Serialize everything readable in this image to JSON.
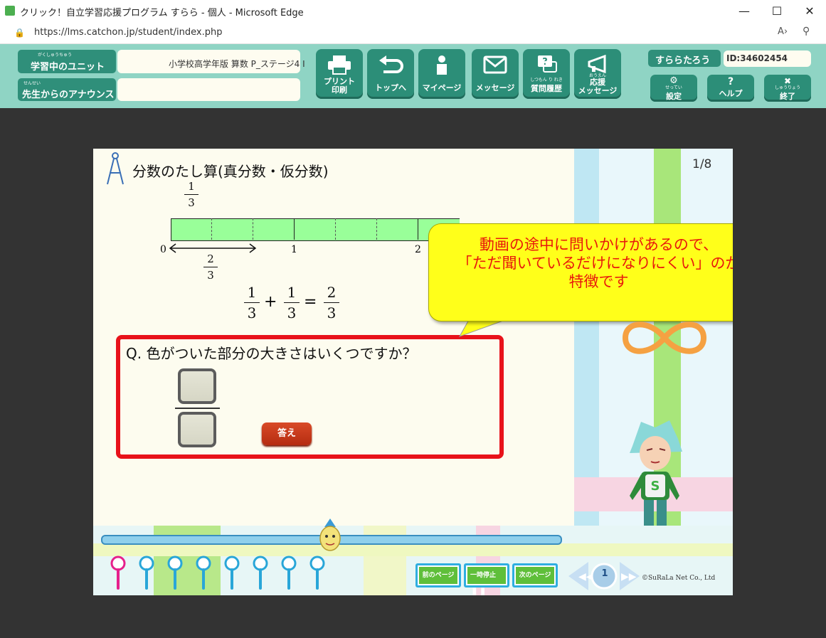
{
  "browser": {
    "title": "クリック！自立学習応援プログラム すらら - 個人 - Microsoft Edge",
    "url": "https://lms.catchon.jp/student/index.php"
  },
  "header": {
    "unit_label": "学習中のユニット",
    "unit_label_ruby": "がくしゅうちゅう",
    "unit_value": "小学校高学年版 算数 P_ステージ4 I",
    "announce_label": "先生からのアナウンス",
    "announce_label_ruby": "せんせい",
    "announce_value": "",
    "toolbar": [
      {
        "label": "プリント\n印刷",
        "ruby": "いんさつ",
        "icon": "printer-icon"
      },
      {
        "label": "トップへ",
        "icon": "return-icon"
      },
      {
        "label": "マイページ",
        "icon": "person-icon"
      },
      {
        "label": "メッセージ",
        "icon": "envelope-icon"
      },
      {
        "label": "質問履歴",
        "ruby": "しつもん り れき",
        "icon": "question-bubble-icon"
      },
      {
        "label": "応援\nメッセージ",
        "ruby": "おうえん",
        "icon": "megaphone-icon"
      }
    ],
    "user_name": "すららたろう",
    "user_id": "ID:34602454",
    "side_buttons": [
      {
        "label": "設定",
        "ruby": "せってい",
        "icon": "gear-icon"
      },
      {
        "label": "ヘルプ",
        "icon": "help-icon",
        "glyph": "?"
      },
      {
        "label": "終了",
        "ruby": "しゅうりょう",
        "icon": "close-icon"
      }
    ]
  },
  "lesson": {
    "title": "分数のたし算(真分数・仮分数)",
    "page_indicator": "1/8",
    "top_fraction": {
      "num": "1",
      "den": "3"
    },
    "numberline_labels": [
      "0",
      "1",
      "2"
    ],
    "arrow_fraction": {
      "num": "2",
      "den": "3"
    },
    "equation": {
      "a_num": "1",
      "a_den": "3",
      "plus": "+",
      "b_num": "1",
      "b_den": "3",
      "eq": "=",
      "c_num": "2",
      "c_den": "3"
    },
    "callout": "動画の途中に問いかけがあるので、\n「ただ聞いているだけになりにくい」のが\n特徴です",
    "question": "Q. 色がついた部分の大きさはいくつですか？",
    "answer_button": "答え",
    "nav": {
      "prev": "前のページ",
      "pause": "一時停止",
      "next": "次のページ",
      "page_number": "1",
      "copyright": "©SuRaLa Net Co., Ltd"
    },
    "progress": 0.5,
    "pins_count": 8
  },
  "colors": {
    "header_bg": "#8fd4c4",
    "button_green": "#2c8e78",
    "callout_yellow": "#ffff1a",
    "callout_text": "#e8180c",
    "question_border": "#e8121a",
    "answer_button": "#c8391c",
    "bar_fill": "#99ff99"
  }
}
